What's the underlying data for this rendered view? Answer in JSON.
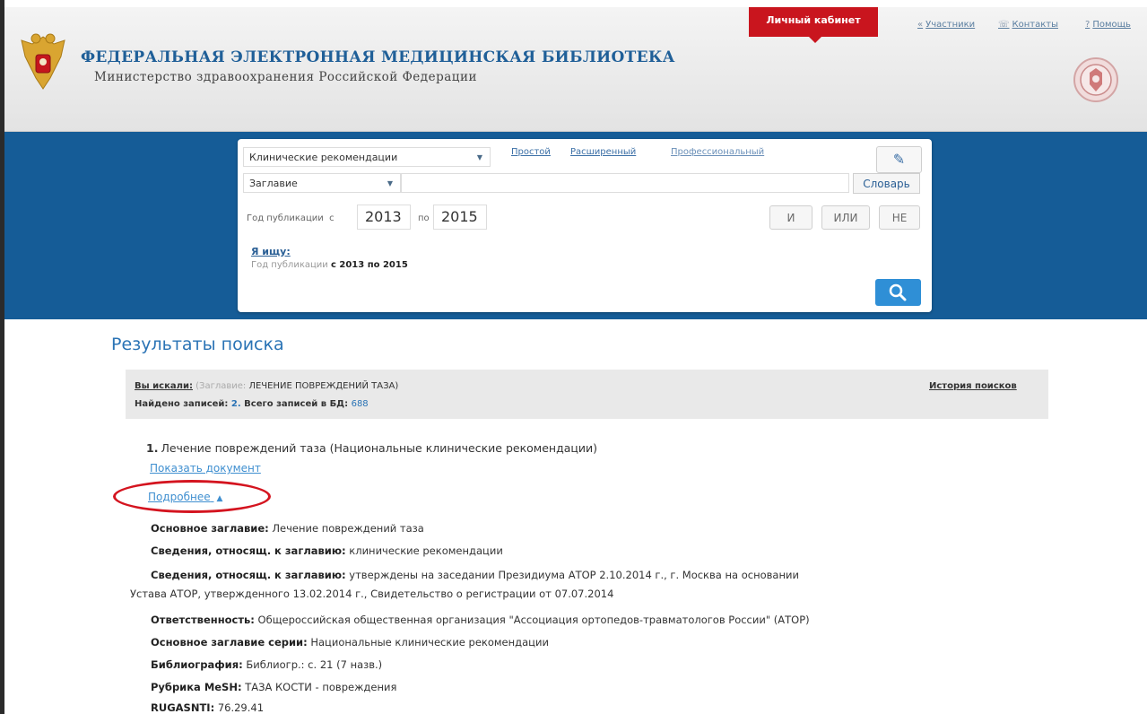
{
  "header": {
    "site_title": "ФЕДЕРАЛЬНАЯ ЭЛЕКТРОННАЯ МЕДИЦИНСКАЯ БИБЛИОТЕКА",
    "site_subtitle": "Министерство здравоохранения Российской Федерации",
    "cabinet_label": "Личный кабинет",
    "links": [
      {
        "icon": "arrows-icon",
        "glyph": "«",
        "label": "Участники"
      },
      {
        "icon": "phone-icon",
        "glyph": "☏",
        "label": "Контакты"
      },
      {
        "icon": "question-icon",
        "glyph": "?",
        "label": "Помощь"
      }
    ]
  },
  "search": {
    "collection": "Клинические рекомендации",
    "modes": [
      "Простой",
      "Расширенный",
      "Профессиональный"
    ],
    "field": "Заглавие",
    "query_value": "",
    "dictionary_label": "Словарь",
    "year_label": "Год публикации",
    "year_from_prefix": "с",
    "year_from": "2013",
    "year_to_prefix": "по",
    "year_to": "2015",
    "operators": [
      "И",
      "ИЛИ",
      "НЕ"
    ],
    "iseek_label": "Я ищу:",
    "iseek_field": "Год публикации",
    "iseek_value": "с 2013 по 2015"
  },
  "results": {
    "title": "Результаты поиска",
    "searched_label": "Вы искали:",
    "searched_field": "(Заглавие:",
    "searched_value": "ЛЕЧЕНИЕ ПОВРЕЖДЕНИЙ ТАЗА)",
    "found_label": "Найдено записей:",
    "found_count": "2.",
    "total_label": "Всего записей в БД:",
    "total_count": "688",
    "history_label": "История поисков"
  },
  "record": {
    "number": "1.",
    "title": "Лечение повреждений таза (Национальные клинические рекомендации)",
    "show_document": "Показать документ",
    "more": "Подробнее",
    "details": [
      {
        "label": "Основное заглавие:",
        "value": "Лечение повреждений таза"
      },
      {
        "label": "Сведения, относящ. к заглавию:",
        "value": "клинические рекомендации"
      },
      {
        "label": "Сведения, относящ. к заглавию:",
        "value": "утверждены на заседании Президиума АТОР 2.10.2014 г., г. Москва на основании",
        "value2": "Устава АТОР, утвержденного 13.02.2014 г., Свидетельство о регистрации от 07.07.2014"
      },
      {
        "label": "Ответственность:",
        "value": "Общероссийская общественная организация \"Ассоциация ортопедов-травматологов России\" (АТОР)"
      },
      {
        "label": "Основное заглавие серии:",
        "value": "Национальные клинические рекомендации"
      },
      {
        "label": "Библиография:",
        "value": "Библиогр.: с. 21 (7 назв.)"
      },
      {
        "label": "Рубрика MeSH:",
        "value": "ТАЗА КОСТИ - повреждения"
      },
      {
        "label": "RUGASNTI:",
        "value": "76.29.41"
      }
    ]
  }
}
